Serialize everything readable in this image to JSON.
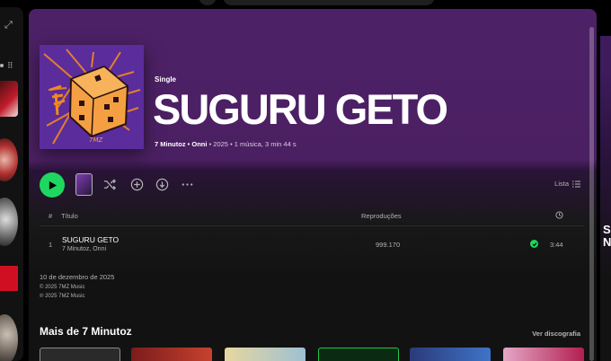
{
  "release": {
    "kind": "Single",
    "title": "SUGURU GETO",
    "artist_primary": "7 Minutoz",
    "artist_secondary": "Onni",
    "year": "2025",
    "summary": "1 música, 3 min 44 s"
  },
  "controls": {
    "list_label": "Lista"
  },
  "table": {
    "headers": {
      "number": "#",
      "title": "Título",
      "plays": "Reproduções"
    },
    "rows": [
      {
        "number": "1",
        "title": "SUGURU GETO",
        "artists": "7 Minutoz, Onni",
        "plays": "999.170",
        "duration": "3:44"
      }
    ]
  },
  "release_info": {
    "date": "10 de dezembro de 2025",
    "copyright_c": "© 2025 7MZ Music",
    "copyright_p": "℗ 2025 7MZ Music"
  },
  "more_section": {
    "title": "Mais de 7 Minutoz",
    "link": "Ver discografia"
  },
  "right_panel": {
    "partial_text_1": "S",
    "partial_text_2": "N"
  },
  "icons": {
    "play": "play-icon",
    "shuffle": "shuffle-icon",
    "add": "add-circle-icon",
    "download": "download-icon",
    "more": "more-icon",
    "list": "list-view-icon",
    "clock": "clock-icon",
    "check": "check-circle-icon",
    "expand": "expand-icon"
  },
  "colors": {
    "accent_green": "#1ed760",
    "header_purple": "#4d2167"
  }
}
